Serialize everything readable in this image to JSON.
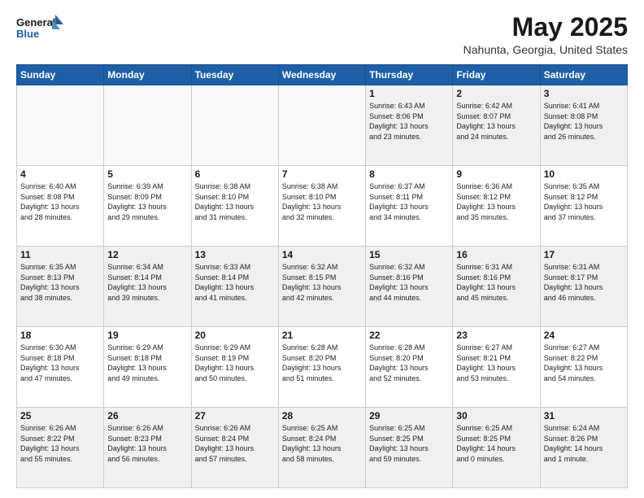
{
  "header": {
    "logo_line1": "General",
    "logo_line2": "Blue",
    "title": "May 2025",
    "subtitle": "Nahunta, Georgia, United States"
  },
  "weekdays": [
    "Sunday",
    "Monday",
    "Tuesday",
    "Wednesday",
    "Thursday",
    "Friday",
    "Saturday"
  ],
  "weeks": [
    [
      {
        "day": "",
        "info": ""
      },
      {
        "day": "",
        "info": ""
      },
      {
        "day": "",
        "info": ""
      },
      {
        "day": "",
        "info": ""
      },
      {
        "day": "1",
        "info": "Sunrise: 6:43 AM\nSunset: 8:06 PM\nDaylight: 13 hours\nand 23 minutes."
      },
      {
        "day": "2",
        "info": "Sunrise: 6:42 AM\nSunset: 8:07 PM\nDaylight: 13 hours\nand 24 minutes."
      },
      {
        "day": "3",
        "info": "Sunrise: 6:41 AM\nSunset: 8:08 PM\nDaylight: 13 hours\nand 26 minutes."
      }
    ],
    [
      {
        "day": "4",
        "info": "Sunrise: 6:40 AM\nSunset: 8:08 PM\nDaylight: 13 hours\nand 28 minutes."
      },
      {
        "day": "5",
        "info": "Sunrise: 6:39 AM\nSunset: 8:09 PM\nDaylight: 13 hours\nand 29 minutes."
      },
      {
        "day": "6",
        "info": "Sunrise: 6:38 AM\nSunset: 8:10 PM\nDaylight: 13 hours\nand 31 minutes."
      },
      {
        "day": "7",
        "info": "Sunrise: 6:38 AM\nSunset: 8:10 PM\nDaylight: 13 hours\nand 32 minutes."
      },
      {
        "day": "8",
        "info": "Sunrise: 6:37 AM\nSunset: 8:11 PM\nDaylight: 13 hours\nand 34 minutes."
      },
      {
        "day": "9",
        "info": "Sunrise: 6:36 AM\nSunset: 8:12 PM\nDaylight: 13 hours\nand 35 minutes."
      },
      {
        "day": "10",
        "info": "Sunrise: 6:35 AM\nSunset: 8:12 PM\nDaylight: 13 hours\nand 37 minutes."
      }
    ],
    [
      {
        "day": "11",
        "info": "Sunrise: 6:35 AM\nSunset: 8:13 PM\nDaylight: 13 hours\nand 38 minutes."
      },
      {
        "day": "12",
        "info": "Sunrise: 6:34 AM\nSunset: 8:14 PM\nDaylight: 13 hours\nand 39 minutes."
      },
      {
        "day": "13",
        "info": "Sunrise: 6:33 AM\nSunset: 8:14 PM\nDaylight: 13 hours\nand 41 minutes."
      },
      {
        "day": "14",
        "info": "Sunrise: 6:32 AM\nSunset: 8:15 PM\nDaylight: 13 hours\nand 42 minutes."
      },
      {
        "day": "15",
        "info": "Sunrise: 6:32 AM\nSunset: 8:16 PM\nDaylight: 13 hours\nand 44 minutes."
      },
      {
        "day": "16",
        "info": "Sunrise: 6:31 AM\nSunset: 8:16 PM\nDaylight: 13 hours\nand 45 minutes."
      },
      {
        "day": "17",
        "info": "Sunrise: 6:31 AM\nSunset: 8:17 PM\nDaylight: 13 hours\nand 46 minutes."
      }
    ],
    [
      {
        "day": "18",
        "info": "Sunrise: 6:30 AM\nSunset: 8:18 PM\nDaylight: 13 hours\nand 47 minutes."
      },
      {
        "day": "19",
        "info": "Sunrise: 6:29 AM\nSunset: 8:18 PM\nDaylight: 13 hours\nand 49 minutes."
      },
      {
        "day": "20",
        "info": "Sunrise: 6:29 AM\nSunset: 8:19 PM\nDaylight: 13 hours\nand 50 minutes."
      },
      {
        "day": "21",
        "info": "Sunrise: 6:28 AM\nSunset: 8:20 PM\nDaylight: 13 hours\nand 51 minutes."
      },
      {
        "day": "22",
        "info": "Sunrise: 6:28 AM\nSunset: 8:20 PM\nDaylight: 13 hours\nand 52 minutes."
      },
      {
        "day": "23",
        "info": "Sunrise: 6:27 AM\nSunset: 8:21 PM\nDaylight: 13 hours\nand 53 minutes."
      },
      {
        "day": "24",
        "info": "Sunrise: 6:27 AM\nSunset: 8:22 PM\nDaylight: 13 hours\nand 54 minutes."
      }
    ],
    [
      {
        "day": "25",
        "info": "Sunrise: 6:26 AM\nSunset: 8:22 PM\nDaylight: 13 hours\nand 55 minutes."
      },
      {
        "day": "26",
        "info": "Sunrise: 6:26 AM\nSunset: 8:23 PM\nDaylight: 13 hours\nand 56 minutes."
      },
      {
        "day": "27",
        "info": "Sunrise: 6:26 AM\nSunset: 8:24 PM\nDaylight: 13 hours\nand 57 minutes."
      },
      {
        "day": "28",
        "info": "Sunrise: 6:25 AM\nSunset: 8:24 PM\nDaylight: 13 hours\nand 58 minutes."
      },
      {
        "day": "29",
        "info": "Sunrise: 6:25 AM\nSunset: 8:25 PM\nDaylight: 13 hours\nand 59 minutes."
      },
      {
        "day": "30",
        "info": "Sunrise: 6:25 AM\nSunset: 8:25 PM\nDaylight: 14 hours\nand 0 minutes."
      },
      {
        "day": "31",
        "info": "Sunrise: 6:24 AM\nSunset: 8:26 PM\nDaylight: 14 hours\nand 1 minute."
      }
    ]
  ]
}
